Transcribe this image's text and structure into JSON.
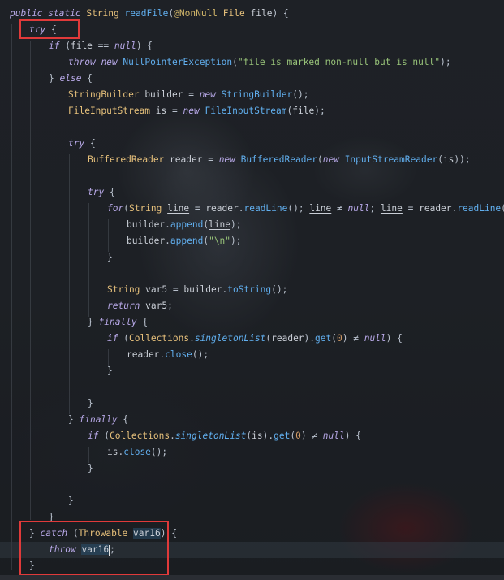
{
  "code": {
    "lines": [
      {
        "indent": 0,
        "tokens": [
          [
            "kw",
            "public"
          ],
          [
            "sp",
            " "
          ],
          [
            "kw",
            "static"
          ],
          [
            "sp",
            " "
          ],
          [
            "type",
            "String"
          ],
          [
            "sp",
            " "
          ],
          [
            "fn",
            "readFile"
          ],
          [
            "op",
            "("
          ],
          [
            "ann",
            "@NonNull"
          ],
          [
            "sp",
            " "
          ],
          [
            "type",
            "File"
          ],
          [
            "sp",
            " "
          ],
          [
            "var",
            "file"
          ],
          [
            "op",
            ") {"
          ]
        ]
      },
      {
        "indent": 1,
        "tokens": [
          [
            "kw",
            "try"
          ],
          [
            "op",
            " {"
          ]
        ]
      },
      {
        "indent": 2,
        "tokens": [
          [
            "kw",
            "if"
          ],
          [
            "op",
            " ("
          ],
          [
            "var",
            "file"
          ],
          [
            "op",
            " == "
          ],
          [
            "kw",
            "null"
          ],
          [
            "op",
            ") {"
          ]
        ]
      },
      {
        "indent": 3,
        "tokens": [
          [
            "kw",
            "throw"
          ],
          [
            "sp",
            " "
          ],
          [
            "kw",
            "new"
          ],
          [
            "sp",
            " "
          ],
          [
            "fn",
            "NullPointerException"
          ],
          [
            "op",
            "("
          ],
          [
            "str",
            "\"file is marked non-null but is null\""
          ],
          [
            "op",
            ");"
          ]
        ]
      },
      {
        "indent": 2,
        "tokens": [
          [
            "op",
            "} "
          ],
          [
            "kw",
            "else"
          ],
          [
            "op",
            " {"
          ]
        ]
      },
      {
        "indent": 3,
        "tokens": [
          [
            "type",
            "StringBuilder"
          ],
          [
            "sp",
            " "
          ],
          [
            "var",
            "builder"
          ],
          [
            "op",
            " = "
          ],
          [
            "kw",
            "new"
          ],
          [
            "sp",
            " "
          ],
          [
            "fn",
            "StringBuilder"
          ],
          [
            "op",
            "();"
          ]
        ]
      },
      {
        "indent": 3,
        "tokens": [
          [
            "type",
            "FileInputStream"
          ],
          [
            "sp",
            " "
          ],
          [
            "var",
            "is"
          ],
          [
            "op",
            " = "
          ],
          [
            "kw",
            "new"
          ],
          [
            "sp",
            " "
          ],
          [
            "fn",
            "FileInputStream"
          ],
          [
            "op",
            "("
          ],
          [
            "var",
            "file"
          ],
          [
            "op",
            ");"
          ]
        ]
      },
      {
        "indent": 0,
        "tokens": []
      },
      {
        "indent": 3,
        "tokens": [
          [
            "kw",
            "try"
          ],
          [
            "op",
            " {"
          ]
        ]
      },
      {
        "indent": 4,
        "tokens": [
          [
            "type",
            "BufferedReader"
          ],
          [
            "sp",
            " "
          ],
          [
            "var",
            "reader"
          ],
          [
            "op",
            " = "
          ],
          [
            "kw",
            "new"
          ],
          [
            "sp",
            " "
          ],
          [
            "fn",
            "BufferedReader"
          ],
          [
            "op",
            "("
          ],
          [
            "kw",
            "new"
          ],
          [
            "sp",
            " "
          ],
          [
            "fn",
            "InputStreamReader"
          ],
          [
            "op",
            "("
          ],
          [
            "var",
            "is"
          ],
          [
            "op",
            "));"
          ]
        ]
      },
      {
        "indent": 0,
        "tokens": []
      },
      {
        "indent": 4,
        "tokens": [
          [
            "kw",
            "try"
          ],
          [
            "op",
            " {"
          ]
        ]
      },
      {
        "indent": 5,
        "tokens": [
          [
            "kw",
            "for"
          ],
          [
            "op",
            "("
          ],
          [
            "type",
            "String"
          ],
          [
            "sp",
            " "
          ],
          [
            "under",
            "line"
          ],
          [
            "op",
            " = "
          ],
          [
            "var",
            "reader"
          ],
          [
            "op",
            "."
          ],
          [
            "fn",
            "readLine"
          ],
          [
            "op",
            "(); "
          ],
          [
            "under",
            "line"
          ],
          [
            "op",
            " ≠ "
          ],
          [
            "kw",
            "null"
          ],
          [
            "op",
            "; "
          ],
          [
            "under",
            "line"
          ],
          [
            "op",
            " = "
          ],
          [
            "var",
            "reader"
          ],
          [
            "op",
            "."
          ],
          [
            "fn",
            "readLine"
          ],
          [
            "op",
            "()) {"
          ]
        ]
      },
      {
        "indent": 6,
        "tokens": [
          [
            "var",
            "builder"
          ],
          [
            "op",
            "."
          ],
          [
            "fn",
            "append"
          ],
          [
            "op",
            "("
          ],
          [
            "under",
            "line"
          ],
          [
            "op",
            ");"
          ]
        ]
      },
      {
        "indent": 6,
        "tokens": [
          [
            "var",
            "builder"
          ],
          [
            "op",
            "."
          ],
          [
            "fn",
            "append"
          ],
          [
            "op",
            "("
          ],
          [
            "str",
            "\"\\n\""
          ],
          [
            "op",
            ");"
          ]
        ]
      },
      {
        "indent": 5,
        "tokens": [
          [
            "op",
            "}"
          ]
        ]
      },
      {
        "indent": 0,
        "tokens": []
      },
      {
        "indent": 5,
        "tokens": [
          [
            "type",
            "String"
          ],
          [
            "sp",
            " "
          ],
          [
            "var",
            "var5"
          ],
          [
            "op",
            " = "
          ],
          [
            "var",
            "builder"
          ],
          [
            "op",
            "."
          ],
          [
            "fn",
            "toString"
          ],
          [
            "op",
            "();"
          ]
        ]
      },
      {
        "indent": 5,
        "tokens": [
          [
            "kw",
            "return"
          ],
          [
            "sp",
            " "
          ],
          [
            "var",
            "var5"
          ],
          [
            "op",
            ";"
          ]
        ]
      },
      {
        "indent": 4,
        "tokens": [
          [
            "op",
            "} "
          ],
          [
            "kw",
            "finally"
          ],
          [
            "op",
            " {"
          ]
        ]
      },
      {
        "indent": 5,
        "tokens": [
          [
            "kw",
            "if"
          ],
          [
            "op",
            " ("
          ],
          [
            "type",
            "Collections"
          ],
          [
            "op",
            "."
          ],
          [
            "fnit",
            "singletonList"
          ],
          [
            "op",
            "("
          ],
          [
            "var",
            "reader"
          ],
          [
            "op",
            ")."
          ],
          [
            "fn",
            "get"
          ],
          [
            "op",
            "("
          ],
          [
            "num",
            "0"
          ],
          [
            "op",
            ") ≠ "
          ],
          [
            "kw",
            "null"
          ],
          [
            "op",
            ") {"
          ]
        ]
      },
      {
        "indent": 6,
        "tokens": [
          [
            "var",
            "reader"
          ],
          [
            "op",
            "."
          ],
          [
            "fn",
            "close"
          ],
          [
            "op",
            "();"
          ]
        ]
      },
      {
        "indent": 5,
        "tokens": [
          [
            "op",
            "}"
          ]
        ]
      },
      {
        "indent": 0,
        "tokens": []
      },
      {
        "indent": 4,
        "tokens": [
          [
            "op",
            "}"
          ]
        ]
      },
      {
        "indent": 3,
        "tokens": [
          [
            "op",
            "} "
          ],
          [
            "kw",
            "finally"
          ],
          [
            "op",
            " {"
          ]
        ]
      },
      {
        "indent": 4,
        "tokens": [
          [
            "kw",
            "if"
          ],
          [
            "op",
            " ("
          ],
          [
            "type",
            "Collections"
          ],
          [
            "op",
            "."
          ],
          [
            "fnit",
            "singletonList"
          ],
          [
            "op",
            "("
          ],
          [
            "var",
            "is"
          ],
          [
            "op",
            ")."
          ],
          [
            "fn",
            "get"
          ],
          [
            "op",
            "("
          ],
          [
            "num",
            "0"
          ],
          [
            "op",
            ") ≠ "
          ],
          [
            "kw",
            "null"
          ],
          [
            "op",
            ") {"
          ]
        ]
      },
      {
        "indent": 5,
        "tokens": [
          [
            "var",
            "is"
          ],
          [
            "op",
            "."
          ],
          [
            "fn",
            "close"
          ],
          [
            "op",
            "();"
          ]
        ]
      },
      {
        "indent": 4,
        "tokens": [
          [
            "op",
            "}"
          ]
        ]
      },
      {
        "indent": 0,
        "tokens": []
      },
      {
        "indent": 3,
        "tokens": [
          [
            "op",
            "}"
          ]
        ]
      },
      {
        "indent": 2,
        "tokens": [
          [
            "op",
            "}"
          ]
        ]
      },
      {
        "indent": 1,
        "tokens": [
          [
            "op",
            "} "
          ],
          [
            "kw",
            "catch"
          ],
          [
            "op",
            " ("
          ],
          [
            "type",
            "Throwable"
          ],
          [
            "sp",
            " "
          ],
          [
            "var16",
            "var16"
          ],
          [
            "op",
            ") {"
          ]
        ]
      },
      {
        "indent": 2,
        "tokens": [
          [
            "kw",
            "throw"
          ],
          [
            "sp",
            " "
          ],
          [
            "var16",
            "var16"
          ],
          [
            "caret",
            ""
          ],
          [
            "op",
            ";"
          ]
        ]
      },
      {
        "indent": 1,
        "tokens": [
          [
            "op",
            "}"
          ]
        ]
      }
    ],
    "current_line": 33
  },
  "colors": {
    "highlight_box": "#e03a3a",
    "keyword": "#b8a9e8",
    "type": "#e6c07b",
    "function": "#61afef",
    "string": "#98c379",
    "number": "#d19a66"
  }
}
